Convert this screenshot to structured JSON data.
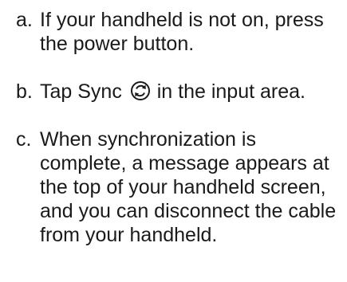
{
  "steps": [
    {
      "marker": "a.",
      "text": "If your handheld is not on, press the power button."
    },
    {
      "marker": "b.",
      "text_before_icon": "Tap Sync",
      "icon": "sync-icon",
      "text_after_icon": " in the input area."
    },
    {
      "marker": "c.",
      "text": "When synchronization is complete, a message appears at the top of your handheld screen, and you can disconnect the cable from your handheld."
    }
  ]
}
